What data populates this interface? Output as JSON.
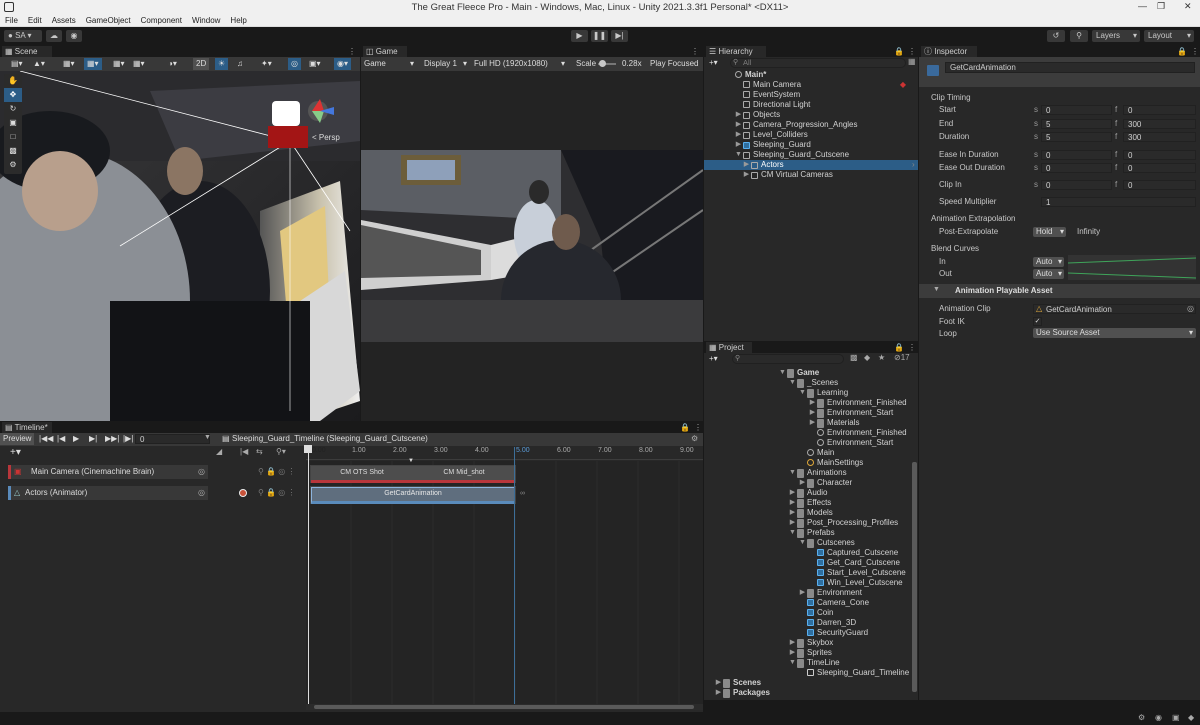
{
  "window": {
    "title": "The Great Fleece Pro - Main - Windows, Mac, Linux - Unity 2021.3.3f1 Personal* <DX11>"
  },
  "menu": [
    "File",
    "Edit",
    "Assets",
    "GameObject",
    "Component",
    "Window",
    "Help"
  ],
  "toolbar": {
    "account": "SA",
    "layers": "Layers",
    "layout": "Layout"
  },
  "scene": {
    "tab": "Scene",
    "mode_2d": "2D",
    "persp": "< Persp"
  },
  "game": {
    "tab": "Game",
    "display_mode": "Game",
    "display": "Display 1",
    "resolution": "Full HD (1920x1080)",
    "scale_label": "Scale",
    "scale_value": "0.28x",
    "play_focused": "Play Focused"
  },
  "hierarchy": {
    "tab": "Hierarchy",
    "search_placeholder": "All",
    "items": [
      {
        "label": "Main*",
        "depth": 0,
        "kind": "scene"
      },
      {
        "label": "Main Camera",
        "depth": 1,
        "kind": "cube"
      },
      {
        "label": "EventSystem",
        "depth": 1,
        "kind": "cube"
      },
      {
        "label": "Directional Light",
        "depth": 1,
        "kind": "cube"
      },
      {
        "label": "Objects",
        "depth": 1,
        "kind": "cube",
        "arrow": "right"
      },
      {
        "label": "Camera_Progression_Angles",
        "depth": 1,
        "kind": "cube",
        "arrow": "right"
      },
      {
        "label": "Level_Colliders",
        "depth": 1,
        "kind": "cube",
        "arrow": "right"
      },
      {
        "label": "Sleeping_Guard",
        "depth": 1,
        "kind": "blue",
        "arrow": "right"
      },
      {
        "label": "Sleeping_Guard_Cutscene",
        "depth": 1,
        "kind": "cube",
        "arrow": "down"
      },
      {
        "label": "Actors",
        "depth": 2,
        "kind": "cube",
        "arrow": "right",
        "selected": true
      },
      {
        "label": "CM Virtual Cameras",
        "depth": 2,
        "kind": "cube",
        "arrow": "right"
      }
    ]
  },
  "inspector": {
    "tab": "Inspector",
    "object_name": "GetCardAnimation",
    "clip_timing": "Clip Timing",
    "rows": [
      {
        "label": "Start",
        "s": "0",
        "f": "0"
      },
      {
        "label": "End",
        "s": "5",
        "f": "300"
      },
      {
        "label": "Duration",
        "s": "5",
        "f": "300"
      },
      {
        "label": "Ease In Duration",
        "s": "0",
        "f": "0"
      },
      {
        "label": "Ease Out Duration",
        "s": "0",
        "f": "0"
      },
      {
        "label": "Clip In",
        "s": "0",
        "f": "0"
      }
    ],
    "s_tag": "s",
    "f_tag": "f",
    "speed_label": "Speed Multiplier",
    "speed_value": "1",
    "extrapolation_title": "Animation Extrapolation",
    "post_label": "Post-Extrapolate",
    "post_value": "Hold",
    "post_extra": "Infinity",
    "blend_title": "Blend Curves",
    "blend_in": "In",
    "blend_out": "Out",
    "blend_in_value": "Auto",
    "blend_out_value": "Auto",
    "asset_title": "Animation Playable Asset",
    "clip_label": "Animation Clip",
    "clip_value": "GetCardAnimation",
    "footik_label": "Foot IK",
    "loop_label": "Loop",
    "loop_value": "Use Source Asset"
  },
  "timeline": {
    "tab": "Timeline*",
    "preview": "Preview",
    "frame": "0",
    "asset": "Sleeping_Guard_Timeline (Sleeping_Guard_Cutscene)",
    "ruler": [
      "1.00",
      "2.00",
      "3.00",
      "4.00",
      "5.00",
      "6.00",
      "7.00",
      "8.00",
      "9.00"
    ],
    "ruler_zero": "0.00",
    "tracks": [
      {
        "label": "Main Camera (Cinemachine Brain)",
        "clips": [
          "CM OTS Shot",
          "CM Mid_shot"
        ]
      },
      {
        "label": "Actors (Animator)",
        "clips": [
          "GetCardAnimation"
        ]
      }
    ]
  },
  "project": {
    "tab": "Project",
    "badge": "17",
    "items": [
      {
        "label": "Game",
        "depth": 0,
        "arrow": "down",
        "kind": "fold"
      },
      {
        "label": "_Scenes",
        "depth": 1,
        "arrow": "down",
        "kind": "fold"
      },
      {
        "label": "Learning",
        "depth": 2,
        "arrow": "down",
        "kind": "fold"
      },
      {
        "label": "Environment_Finished",
        "depth": 3,
        "arrow": "right",
        "kind": "fold"
      },
      {
        "label": "Environment_Start",
        "depth": 3,
        "arrow": "right",
        "kind": "fold"
      },
      {
        "label": "Materials",
        "depth": 3,
        "arrow": "right",
        "kind": "fold"
      },
      {
        "label": "Environment_Finished",
        "depth": 3,
        "kind": "scene"
      },
      {
        "label": "Environment_Start",
        "depth": 3,
        "kind": "scene"
      },
      {
        "label": "Main",
        "depth": 2,
        "kind": "scene"
      },
      {
        "label": "MainSettings",
        "depth": 2,
        "kind": "settings"
      },
      {
        "label": "Animations",
        "depth": 1,
        "arrow": "down",
        "kind": "fold"
      },
      {
        "label": "Character",
        "depth": 2,
        "arrow": "right",
        "kind": "fold"
      },
      {
        "label": "Audio",
        "depth": 1,
        "arrow": "right",
        "kind": "fold"
      },
      {
        "label": "Effects",
        "depth": 1,
        "arrow": "right",
        "kind": "fold"
      },
      {
        "label": "Models",
        "depth": 1,
        "arrow": "right",
        "kind": "fold"
      },
      {
        "label": "Post_Processing_Profiles",
        "depth": 1,
        "arrow": "right",
        "kind": "fold"
      },
      {
        "label": "Prefabs",
        "depth": 1,
        "arrow": "down",
        "kind": "fold"
      },
      {
        "label": "Cutscenes",
        "depth": 2,
        "arrow": "down",
        "kind": "fold"
      },
      {
        "label": "Captured_Cutscene",
        "depth": 3,
        "kind": "blue"
      },
      {
        "label": "Get_Card_Cutscene",
        "depth": 3,
        "kind": "blue"
      },
      {
        "label": "Start_Level_Cutscene",
        "depth": 3,
        "kind": "blue"
      },
      {
        "label": "Win_Level_Cutscene",
        "depth": 3,
        "kind": "blue"
      },
      {
        "label": "Environment",
        "depth": 2,
        "arrow": "right",
        "kind": "fold"
      },
      {
        "label": "Camera_Cone",
        "depth": 2,
        "kind": "blue"
      },
      {
        "label": "Coin",
        "depth": 2,
        "kind": "blue"
      },
      {
        "label": "Darren_3D",
        "depth": 2,
        "kind": "blue"
      },
      {
        "label": "SecurityGuard",
        "depth": 2,
        "kind": "blue"
      },
      {
        "label": "Skybox",
        "depth": 1,
        "arrow": "right",
        "kind": "fold"
      },
      {
        "label": "Sprites",
        "depth": 1,
        "arrow": "right",
        "kind": "fold"
      },
      {
        "label": "TimeLine",
        "depth": 1,
        "arrow": "down",
        "kind": "fold"
      },
      {
        "label": "Sleeping_Guard_Timeline",
        "depth": 2,
        "kind": "timeline"
      },
      {
        "label": "Scenes",
        "depth": -1,
        "arrow": "right",
        "kind": "fold"
      },
      {
        "label": "Packages",
        "depth": -2,
        "arrow": "right",
        "kind": "fold",
        "bold": true
      }
    ]
  },
  "colors": {
    "accent": "#2c5d87",
    "panel": "#282828",
    "dark": "#191919",
    "clip_anim": "#5a8bbb",
    "clip_cam": "#b8363b"
  }
}
